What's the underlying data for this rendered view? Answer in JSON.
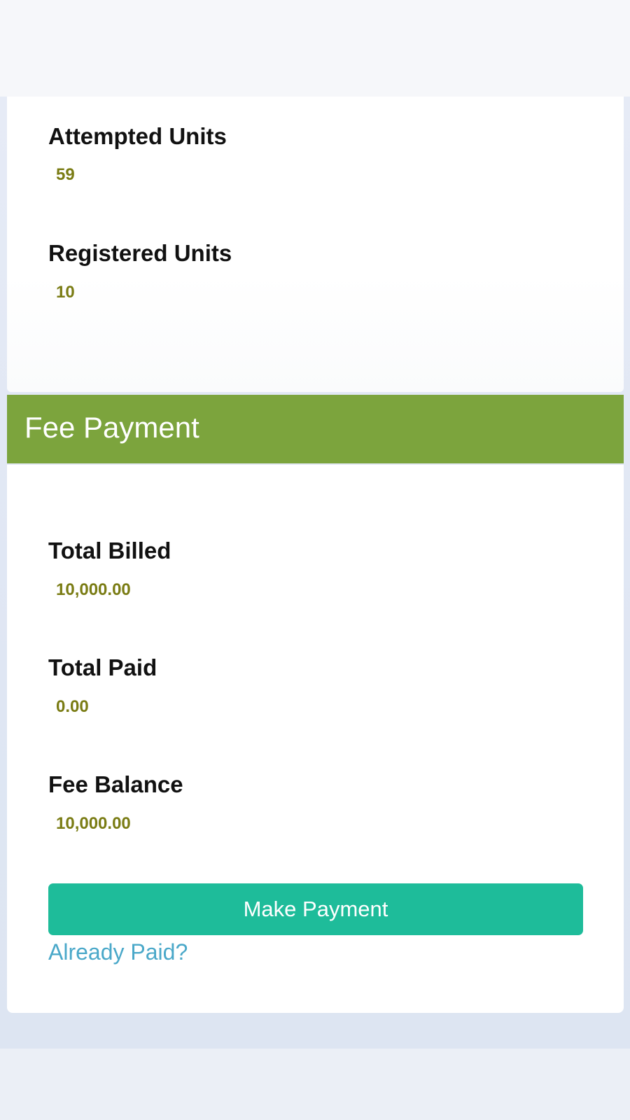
{
  "units": {
    "attempted": {
      "label": "Attempted Units",
      "value": "59"
    },
    "registered": {
      "label": "Registered Units",
      "value": "10"
    }
  },
  "fee": {
    "title": "Fee Payment",
    "total_billed": {
      "label": "Total Billed",
      "value": "10,000.00"
    },
    "total_paid": {
      "label": "Total Paid",
      "value": "0.00"
    },
    "balance": {
      "label": "Fee Balance",
      "value": "10,000.00"
    },
    "make_payment_label": "Make Payment",
    "already_paid_label": "Already Paid?"
  },
  "colors": {
    "header_green": "#7ca43d",
    "button_teal": "#1ebc9a",
    "value_olive": "#7a7c14",
    "link_blue": "#4aa8c9"
  }
}
